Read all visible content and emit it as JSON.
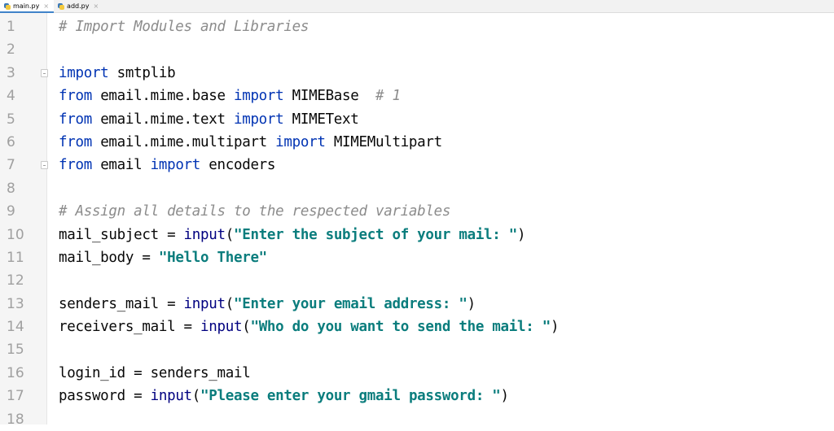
{
  "tabs": [
    {
      "label": "main.py",
      "active": true,
      "icon": "python-file-icon"
    },
    {
      "label": "add.py",
      "active": false,
      "icon": "python-file-icon"
    }
  ],
  "colors": {
    "keyword": "#0033b3",
    "builtin": "#000080",
    "string": "#0b7d7d",
    "comment": "#8c8c8c",
    "text": "#080808",
    "gutter_bg": "#f5f5f5",
    "active_tab_underline": "#4083c9"
  },
  "editor": {
    "line_numbers": [
      "1",
      "2",
      "3",
      "4",
      "5",
      "6",
      "7",
      "8",
      "9",
      "10",
      "11",
      "12",
      "13",
      "14",
      "15",
      "16",
      "17",
      "18"
    ],
    "lines": [
      [
        {
          "t": "cm",
          "v": "# Import Modules and Libraries"
        }
      ],
      [],
      [
        {
          "t": "kw",
          "v": "import"
        },
        {
          "t": "tx",
          "v": " smtplib"
        }
      ],
      [
        {
          "t": "kw",
          "v": "from"
        },
        {
          "t": "tx",
          "v": " email.mime.base "
        },
        {
          "t": "kw",
          "v": "import"
        },
        {
          "t": "tx",
          "v": " MIMEBase  "
        },
        {
          "t": "cm",
          "v": "# 1"
        }
      ],
      [
        {
          "t": "kw",
          "v": "from"
        },
        {
          "t": "tx",
          "v": " email.mime.text "
        },
        {
          "t": "kw",
          "v": "import"
        },
        {
          "t": "tx",
          "v": " MIMEText"
        }
      ],
      [
        {
          "t": "kw",
          "v": "from"
        },
        {
          "t": "tx",
          "v": " email.mime.multipart "
        },
        {
          "t": "kw",
          "v": "import"
        },
        {
          "t": "tx",
          "v": " MIMEMultipart"
        }
      ],
      [
        {
          "t": "kw",
          "v": "from"
        },
        {
          "t": "tx",
          "v": " email "
        },
        {
          "t": "kw",
          "v": "import"
        },
        {
          "t": "tx",
          "v": " encoders"
        }
      ],
      [],
      [
        {
          "t": "cm",
          "v": "# Assign all details to the respected variables"
        }
      ],
      [
        {
          "t": "tx",
          "v": "mail_subject = "
        },
        {
          "t": "bi",
          "v": "input"
        },
        {
          "t": "tx",
          "v": "("
        },
        {
          "t": "str",
          "v": "\"Enter the subject of your mail: \""
        },
        {
          "t": "tx",
          "v": ")"
        }
      ],
      [
        {
          "t": "tx",
          "v": "mail_body = "
        },
        {
          "t": "str",
          "v": "\"Hello There\""
        }
      ],
      [],
      [
        {
          "t": "tx",
          "v": "senders_mail = "
        },
        {
          "t": "bi",
          "v": "input"
        },
        {
          "t": "tx",
          "v": "("
        },
        {
          "t": "str",
          "v": "\"Enter your email address: \""
        },
        {
          "t": "tx",
          "v": ")"
        }
      ],
      [
        {
          "t": "tx",
          "v": "receivers_mail = "
        },
        {
          "t": "bi",
          "v": "input"
        },
        {
          "t": "tx",
          "v": "("
        },
        {
          "t": "str",
          "v": "\"Who do you want to send the mail: \""
        },
        {
          "t": "tx",
          "v": ")"
        }
      ],
      [],
      [
        {
          "t": "tx",
          "v": "login_id = senders_mail"
        }
      ],
      [
        {
          "t": "tx",
          "v": "password = "
        },
        {
          "t": "bi",
          "v": "input"
        },
        {
          "t": "tx",
          "v": "("
        },
        {
          "t": "str",
          "v": "\"Please enter your gmail password: \""
        },
        {
          "t": "tx",
          "v": ")"
        }
      ],
      []
    ],
    "fold_markers_on_lines": [
      3,
      7
    ]
  }
}
